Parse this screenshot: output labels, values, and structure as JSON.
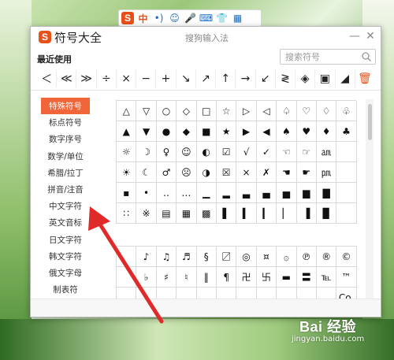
{
  "ime_toolbar": {
    "logo": "S",
    "buttons": [
      {
        "name": "lang-zh-button",
        "glyph": "中"
      },
      {
        "name": "punct-button",
        "glyph": "•)"
      },
      {
        "name": "emoji-button",
        "glyph": "☺"
      },
      {
        "name": "voice-button",
        "glyph": "🎤"
      },
      {
        "name": "keyboard-button",
        "glyph": "⌨"
      },
      {
        "name": "skin-button",
        "glyph": "👕"
      },
      {
        "name": "toolbox-button",
        "glyph": "▦"
      }
    ]
  },
  "window": {
    "logo": "S",
    "title": "符号大全",
    "subtitle": "搜狗输入法",
    "minimize": "—",
    "close": "✕",
    "recent_label": "最近使用",
    "search_placeholder": "搜索符号"
  },
  "recent_symbols": [
    "＜",
    "≪",
    "≫",
    "÷",
    "×",
    "−",
    "+",
    "↘",
    "↗",
    "↑",
    "→",
    "↙",
    "≷",
    "◈",
    "▣",
    "◢"
  ],
  "recent_trash": "🗑",
  "categories": [
    {
      "label": "特殊符号",
      "active": true
    },
    {
      "label": "标点符号",
      "active": false
    },
    {
      "label": "数字序号",
      "active": false
    },
    {
      "label": "数学/单位",
      "active": false
    },
    {
      "label": "希腊/拉丁",
      "active": false
    },
    {
      "label": "拼音/注音",
      "active": false
    },
    {
      "label": "中文字符",
      "active": false
    },
    {
      "label": "英文音标",
      "active": false
    },
    {
      "label": "日文字符",
      "active": false
    },
    {
      "label": "韩文字符",
      "active": false
    },
    {
      "label": "俄文字母",
      "active": false
    },
    {
      "label": "制表符",
      "active": false
    }
  ],
  "symbols_top": [
    [
      "△",
      "▽",
      "○",
      "◇",
      "□",
      "☆",
      "▷",
      "◁",
      "♤",
      "♡",
      "♢",
      "♧"
    ],
    [
      "▲",
      "▼",
      "●",
      "◆",
      "■",
      "★",
      "▶",
      "◀",
      "♠",
      "♥",
      "♦",
      "♣"
    ],
    [
      "☼",
      "☽",
      "♀",
      "☺",
      "◐",
      "☑",
      "√",
      "✓",
      "☜",
      "☞",
      "㏂",
      ""
    ],
    [
      "☀",
      "☾",
      "♂",
      "☹",
      "◑",
      "☒",
      "×",
      "✗",
      "☚",
      "☛",
      "㏘",
      ""
    ],
    [
      "▪",
      "•",
      "‥",
      "…",
      "▁",
      "▂",
      "▃",
      "▄",
      "▅",
      "▆",
      "▇",
      ""
    ],
    [
      "∷",
      "※",
      "▤",
      "▦",
      "▩",
      "▌",
      "▍",
      "▎",
      "▏",
      "▐",
      "▉",
      ""
    ]
  ],
  "symbols_bottom": [
    [
      "",
      "♪",
      "♫",
      "♬",
      "§",
      "〼",
      "◎",
      "¤",
      "۞",
      "℗",
      "®",
      "©"
    ],
    [
      "",
      "♭",
      "♯",
      "♮",
      "‖",
      "¶",
      "卍",
      "卐",
      "▬",
      "〓",
      "℡",
      "™"
    ],
    [
      "",
      "",
      "",
      "",
      "",
      "",
      "",
      "",
      "",
      "",
      "",
      "Co."
    ]
  ],
  "watermark": {
    "brand": "Bai 经验",
    "url": "jingyan.baidu.com"
  }
}
